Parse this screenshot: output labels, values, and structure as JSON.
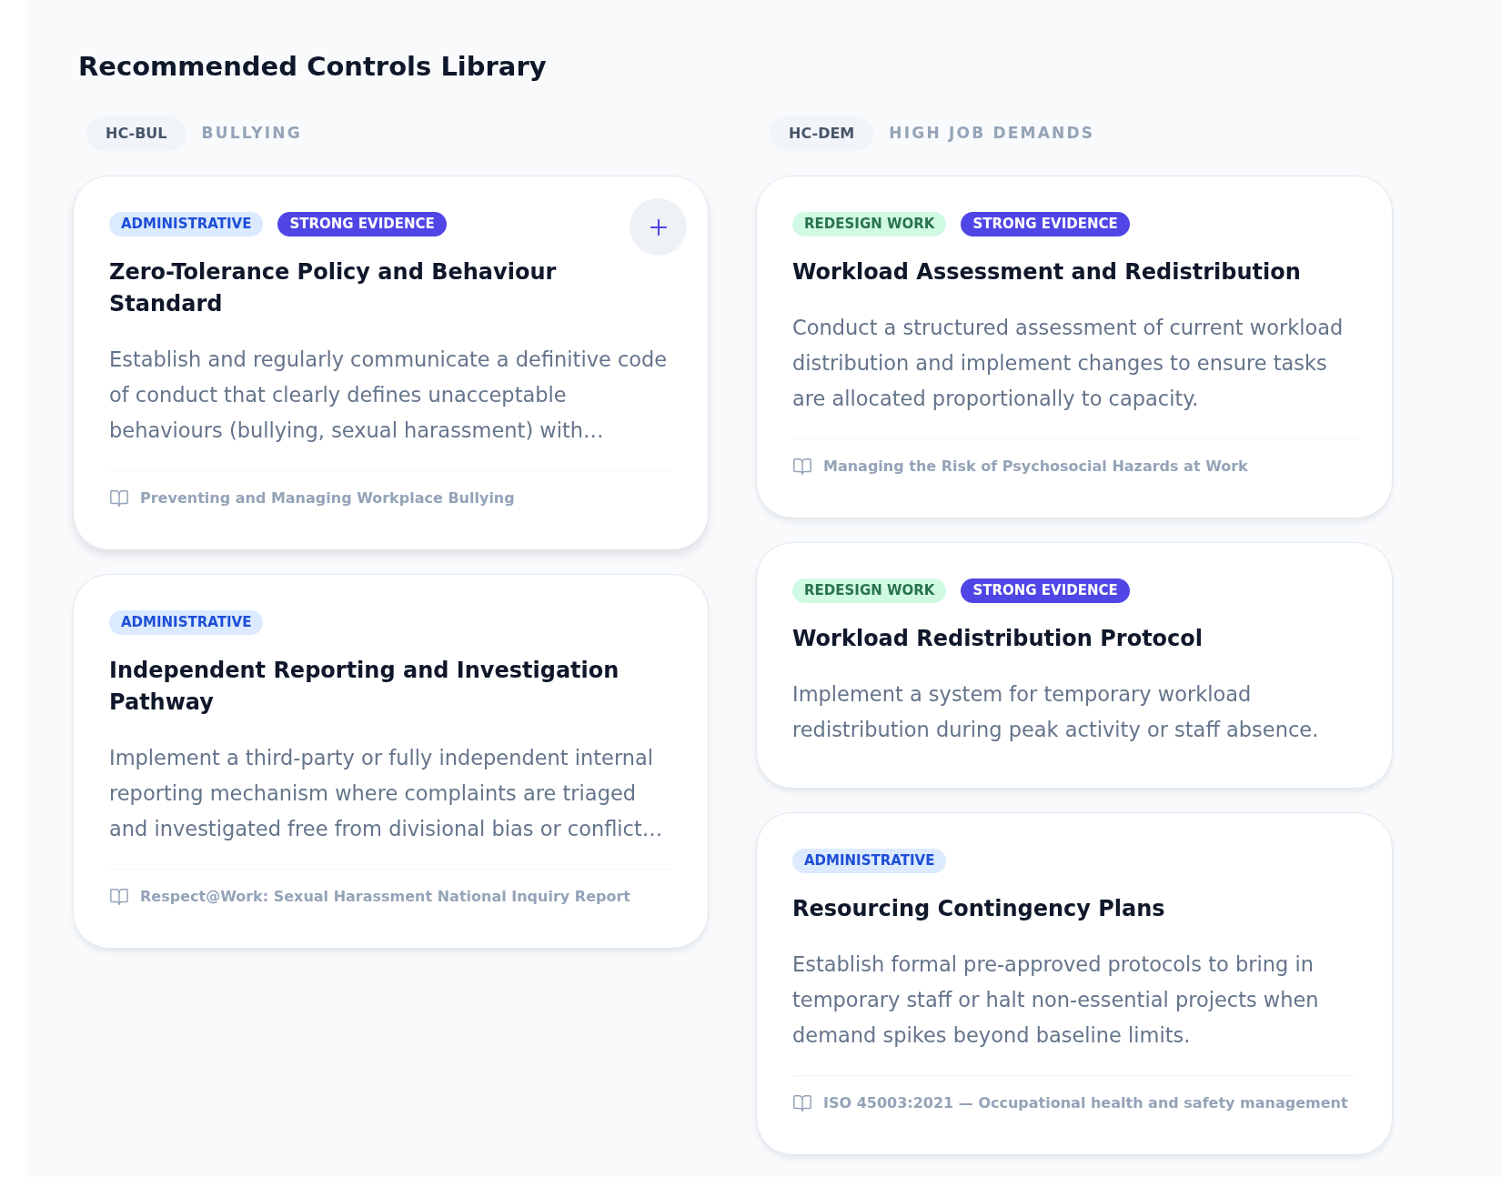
{
  "page": {
    "title": "Recommended Controls Library"
  },
  "groups": [
    {
      "code": "HC-BUL",
      "name": "BULLYING",
      "controls": [
        {
          "hovered": true,
          "tags": [
            {
              "kind": "administrative",
              "label": "ADMINISTRATIVE"
            },
            {
              "kind": "evidence",
              "label": "STRONG EVIDENCE"
            }
          ],
          "title": "Zero-Tolerance Policy and Behaviour Standard",
          "description": "Establish and regularly communicate a definitive code of conduct that clearly defines unacceptable behaviours (bullying, sexual harassment) with…",
          "source": "Preventing and Managing Workplace Bullying"
        },
        {
          "hovered": false,
          "tags": [
            {
              "kind": "administrative",
              "label": "ADMINISTRATIVE"
            }
          ],
          "title": "Independent Reporting and Investigation Pathway",
          "description": "Implement a third-party or fully independent internal reporting mechanism where complaints are triaged and investigated free from divisional bias or conflict…",
          "source": "Respect@Work: Sexual Harassment National Inquiry Report"
        }
      ]
    },
    {
      "code": "HC-DEM",
      "name": "HIGH JOB DEMANDS",
      "controls": [
        {
          "hovered": false,
          "tags": [
            {
              "kind": "redesign",
              "label": "REDESIGN WORK"
            },
            {
              "kind": "evidence",
              "label": "STRONG EVIDENCE"
            }
          ],
          "title": "Workload Assessment and Redistribution",
          "description": "Conduct a structured assessment of current workload distribution and implement changes to ensure tasks are allocated proportionally to capacity.",
          "source": "Managing the Risk of Psychosocial Hazards at Work"
        },
        {
          "hovered": false,
          "tags": [
            {
              "kind": "redesign",
              "label": "REDESIGN WORK"
            },
            {
              "kind": "evidence",
              "label": "STRONG EVIDENCE"
            }
          ],
          "title": "Workload Redistribution Protocol",
          "description": "Implement a system for temporary workload redistribution during peak activity or staff absence."
        },
        {
          "hovered": false,
          "tags": [
            {
              "kind": "administrative",
              "label": "ADMINISTRATIVE"
            }
          ],
          "title": "Resourcing Contingency Plans",
          "description": "Establish formal pre-approved protocols to bring in temporary staff or halt non-essential projects when demand spikes beyond baseline limits.",
          "source": "ISO 45003:2021 — Occupational health and safety management"
        }
      ]
    }
  ]
}
